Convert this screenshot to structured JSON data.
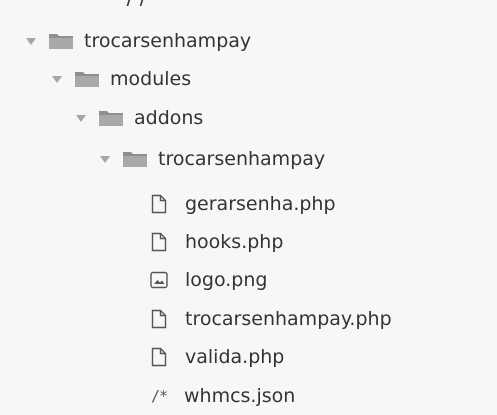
{
  "top_fragment": " / / ",
  "tree": {
    "root": {
      "label": "trocarsenhampay"
    },
    "modules": {
      "label": "modules"
    },
    "addons": {
      "label": "addons"
    },
    "plugin": {
      "label": "trocarsenhampay"
    },
    "files": [
      {
        "label": "gerarsenha.php",
        "icon": "file-icon"
      },
      {
        "label": "hooks.php",
        "icon": "file-icon"
      },
      {
        "label": "logo.png",
        "icon": "image-icon"
      },
      {
        "label": "trocarsenhampay.php",
        "icon": "file-icon"
      },
      {
        "label": "valida.php",
        "icon": "file-icon"
      },
      {
        "label": "whmcs.json",
        "icon": "json-icon"
      }
    ],
    "json_icon_glyph": "/*"
  }
}
